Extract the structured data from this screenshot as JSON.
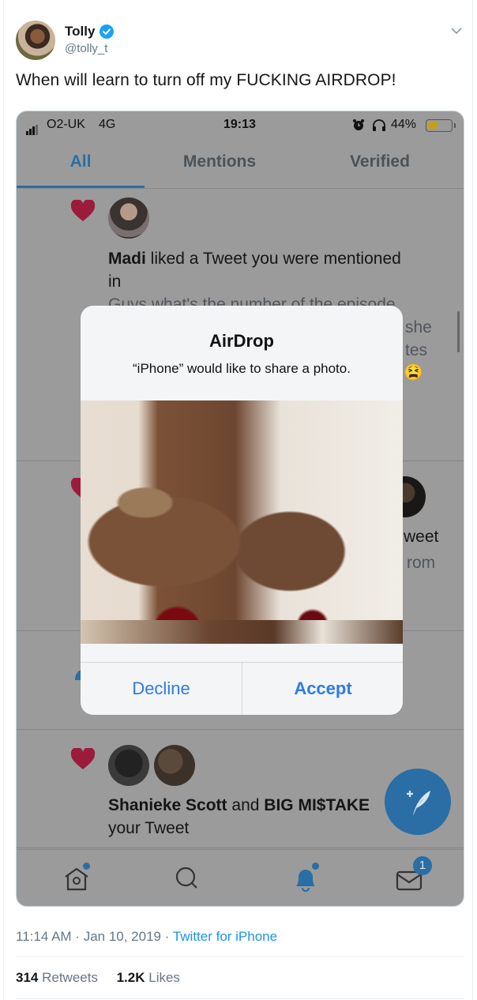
{
  "tweet": {
    "author_name": "Tolly",
    "author_handle": "@tolly_t",
    "verified": true,
    "text": "When will learn to turn off my FUCKING AIRDROP!",
    "time": "11:14 AM",
    "separator": " · ",
    "date": "Jan 10, 2019",
    "source": "Twitter for iPhone",
    "retweets_count": "314",
    "retweets_label": " Retweets",
    "likes_count": "1.2K",
    "likes_label": " Likes"
  },
  "phone": {
    "status_bar": {
      "carrier": "O2-UK",
      "network": "4G",
      "time": "19:13",
      "battery_percent": "44%",
      "battery_level": 0.44
    },
    "tabs": [
      {
        "label": "All",
        "active": true
      },
      {
        "label": "Mentions",
        "active": false
      },
      {
        "label": "Verified",
        "active": false
      }
    ],
    "notifications": [
      {
        "type": "like",
        "actor": "Madi",
        "action": " liked a Tweet you were mentioned",
        "action_cont": "in",
        "preview_line1": "Guys what's the number of the episode",
        "preview_line2": "she",
        "preview_line3": "tes",
        "emoji": "😫"
      },
      {
        "type": "like",
        "partial_line1": "weet",
        "partial_line2": "rom"
      },
      {
        "type": "follow"
      },
      {
        "type": "like",
        "actor1": "Shanieke Scott",
        "joiner": " and ",
        "actor2": "BIG MI$TAKE",
        "action_cont": "your Tweet"
      }
    ],
    "airdrop_dialog": {
      "title": "AirDrop",
      "message": "“iPhone” would like to share a photo.",
      "decline_label": "Decline",
      "accept_label": "Accept"
    },
    "bottom_nav": {
      "items": [
        "home",
        "search",
        "notifications",
        "messages"
      ],
      "messages_badge": "1"
    },
    "colors": {
      "accent": "#2a6ea5",
      "heart": "#9b1b3b",
      "dialog_button": "#2f7ae5"
    }
  }
}
